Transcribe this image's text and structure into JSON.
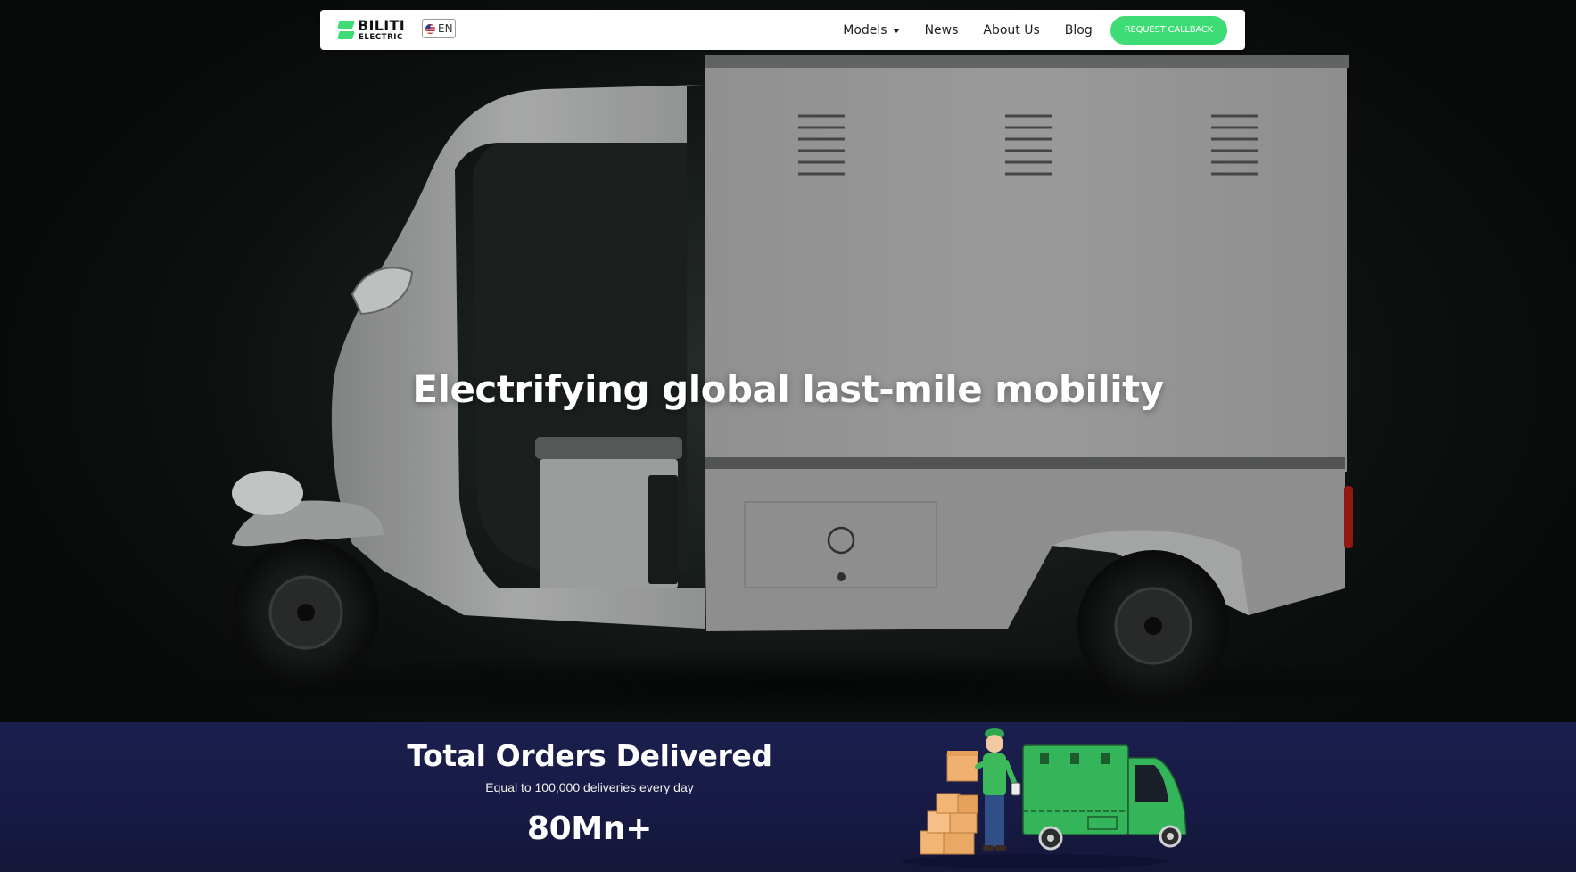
{
  "navbar": {
    "logo": {
      "line1": "BILITI",
      "line2": "ELECTRIC"
    },
    "language": {
      "label": "EN",
      "flag_icon": "us-flag-icon"
    },
    "links": [
      {
        "label": "Models",
        "has_dropdown": true
      },
      {
        "label": "News"
      },
      {
        "label": "About Us"
      },
      {
        "label": "Blog"
      }
    ],
    "cta_label": "REQUEST CALLBACK"
  },
  "hero": {
    "headline": "Electrifying global last-mile mobility"
  },
  "stats": {
    "title": "Total Orders Delivered",
    "subtitle": "Equal to 100,000 deliveries every day",
    "value": "80Mn+"
  },
  "colors": {
    "accent_green": "#3ddc74",
    "stats_background": "#1b1f4e",
    "hero_background": "#1a201e",
    "text_white": "#ffffff"
  }
}
